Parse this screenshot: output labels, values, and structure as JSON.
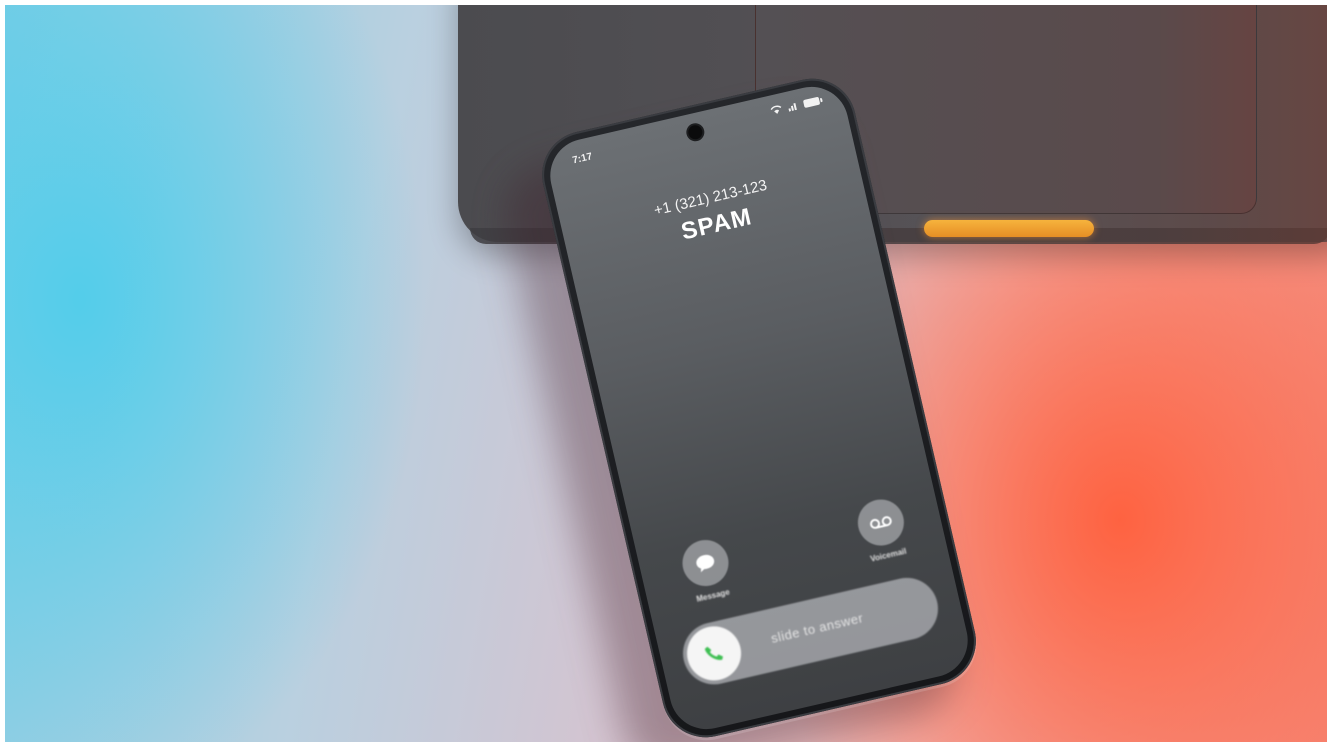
{
  "phone": {
    "status_time": "7:17",
    "caller_number": "+1 (321) 213-123",
    "caller_label": "SPAM",
    "actions": {
      "message_label": "Message",
      "voicemail_label": "Voicemail"
    },
    "slider_text": "slide to answer",
    "icons": [
      "wifi-icon",
      "signal-icon",
      "battery-icon",
      "message-icon",
      "voicemail-icon",
      "phone-icon"
    ]
  },
  "colors": {
    "left_tint": "#50cdeb",
    "right_tint": "#ff5f3c",
    "latch": "#f6b33d",
    "answer_icon": "#3fbf53"
  }
}
